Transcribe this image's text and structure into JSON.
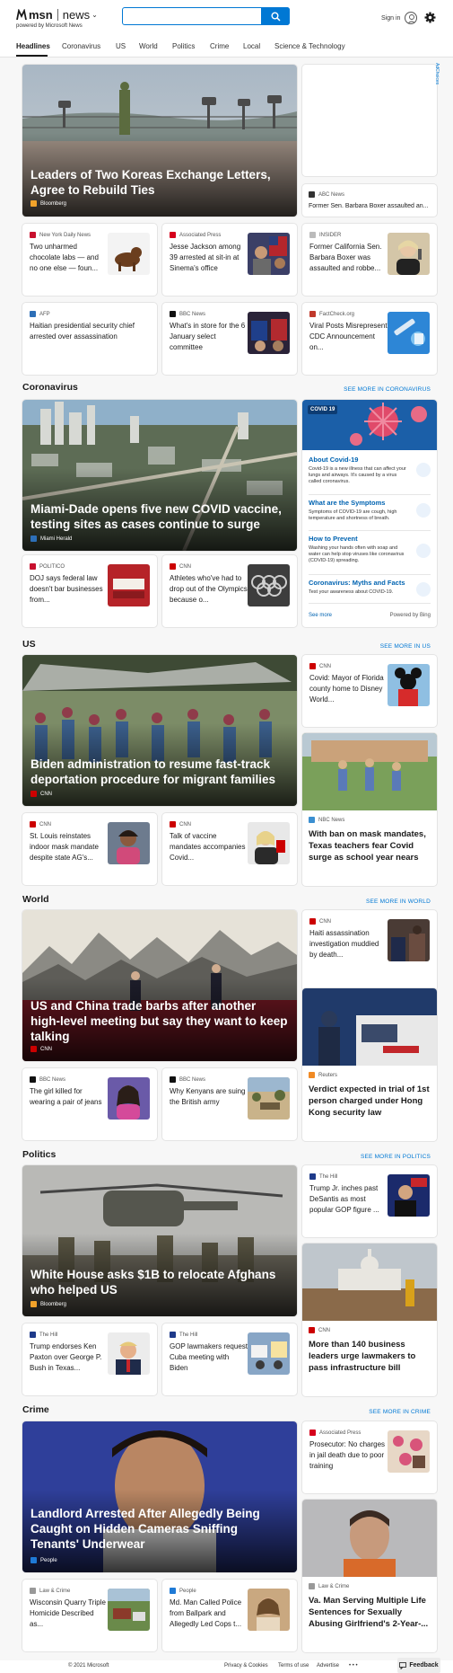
{
  "header": {
    "brand_msn": "msn",
    "brand_news": "news",
    "powered_by": "powered by Microsoft News",
    "search_placeholder": "",
    "sign_in": "Sign in"
  },
  "nav": {
    "items": [
      "Headlines",
      "Coronavirus",
      "US",
      "World",
      "Politics",
      "Crime",
      "Local",
      "Science & Technology"
    ]
  },
  "colors": {
    "accent": "#0078d4",
    "covid_blue": "#1b5fa8",
    "link_blue": "#0063b1"
  },
  "headlines": {
    "hero": {
      "title": "Leaders of Two Koreas Exchange Letters, Agree to Rebuild Ties",
      "source": "Bloomberg"
    },
    "side": {
      "source": "ABC News",
      "title": "Former Sen. Barbara Boxer assaulted an..."
    },
    "adchoices": "AdChoices",
    "cards": [
      {
        "source": "New York Daily News",
        "title": "Two unharmed chocolate labs — and no one else — foun..."
      },
      {
        "source": "Associated Press",
        "title": "Jesse Jackson among 39 arrested at sit-in at Sinema's office"
      },
      {
        "source": "INSIDER",
        "title": "Former California Sen. Barbara Boxer was assaulted and robbe..."
      },
      {
        "source": "AFP",
        "title": "Haitian presidential security chief arrested over assassination"
      },
      {
        "source": "BBC News",
        "title": "What's in store for the 6 January select committee"
      },
      {
        "source": "FactCheck.org",
        "title": "Viral Posts Misrepresent CDC Announcement on..."
      }
    ]
  },
  "coronavirus": {
    "heading": "Coronavirus",
    "see_more": "SEE MORE IN CORONAVIRUS",
    "hero": {
      "title": "Miami-Dade opens five new COVID vaccine, testing sites as cases continue to surge",
      "source": "Miami Herald"
    },
    "cards": [
      {
        "source": "POLITICO",
        "title": "DOJ says federal law doesn't bar businesses from..."
      },
      {
        "source": "CNN",
        "title": "Athletes who've had to drop out of the Olympics because o..."
      }
    ],
    "widget": {
      "badge": "COVID 19",
      "items": [
        {
          "title": "About Covid-19",
          "text": "Covid-19 is a new illness that can affect your lungs and airways. It's caused by a virus called coronavirus."
        },
        {
          "title": "What are the Symptoms",
          "text": "Symptoms of COVID-19 are cough, high temperature and shortness of breath."
        },
        {
          "title": "How to Prevent",
          "text": "Washing your hands often with soap and water can help stop viruses like coronavirus (COVID-19) spreading."
        },
        {
          "title": "Coronavirus: Myths and Facts",
          "text": "Test your awareness about COVID-19."
        }
      ],
      "see_more": "See more",
      "powered": "Powered by Bing"
    }
  },
  "us": {
    "heading": "US",
    "see_more": "SEE MORE IN US",
    "hero": {
      "title": "Biden administration to resume fast-track deportation procedure for migrant families",
      "source": "CNN"
    },
    "side": {
      "source": "CNN",
      "title": "Covid: Mayor of Florida county home to Disney World..."
    },
    "big": {
      "source": "NBC News",
      "title": "With ban on mask mandates, Texas teachers fear Covid surge as school year nears"
    },
    "cards": [
      {
        "source": "CNN",
        "title": "St. Louis reinstates indoor mask mandate despite state AG's..."
      },
      {
        "source": "CNN",
        "title": "Talk of vaccine mandates accompanies Covid..."
      }
    ]
  },
  "world": {
    "heading": "World",
    "see_more": "SEE MORE IN WORLD",
    "hero": {
      "title": "US and China trade barbs after another high-level meeting but say they want to keep talking",
      "source": "CNN"
    },
    "side": {
      "source": "CNN",
      "title": "Haiti assassination investigation muddied by death..."
    },
    "big": {
      "source": "Reuters",
      "title": "Verdict expected in trial of 1st person charged under Hong Kong security law"
    },
    "cards": [
      {
        "source": "BBC News",
        "title": "The girl killed for wearing a pair of jeans"
      },
      {
        "source": "BBC News",
        "title": "Why Kenyans are suing the British army"
      }
    ]
  },
  "politics": {
    "heading": "Politics",
    "see_more": "SEE MORE IN POLITICS",
    "hero": {
      "title": "White House asks $1B to relocate Afghans who helped US",
      "source": "Bloomberg"
    },
    "side": {
      "source": "The Hill",
      "title": "Trump Jr. inches past DeSantis as most popular GOP figure ..."
    },
    "big": {
      "source": "CNN",
      "title": "More than 140 business leaders urge lawmakers to pass infrastructure bill"
    },
    "cards": [
      {
        "source": "The Hill",
        "title": "Trump endorses Ken Paxton over George P. Bush in Texas..."
      },
      {
        "source": "The Hill",
        "title": "GOP lawmakers request Cuba meeting with Biden"
      }
    ]
  },
  "crime": {
    "heading": "Crime",
    "see_more": "SEE MORE IN CRIME",
    "hero": {
      "title": "Landlord Arrested After Allegedly Being Caught on Hidden Cameras Sniffing Tenants' Underwear",
      "source": "People"
    },
    "side": {
      "source": "Associated Press",
      "title": "Prosecutor: No charges in jail death due to poor training"
    },
    "big": {
      "source": "Law & Crime",
      "title": "Va. Man Serving Multiple Life Sentences for Sexually Abusing Girlfriend's 2-Year-..."
    },
    "cards": [
      {
        "source": "Law & Crime",
        "title": "Wisconsin Quarry Triple Homicide Described as..."
      },
      {
        "source": "People",
        "title": "Md. Man Called Police from Ballpark and Allegedly Led Cops t..."
      }
    ]
  },
  "footer": {
    "copyright": "© 2021 Microsoft",
    "links": [
      "Privacy & Cookies",
      "Terms of use",
      "Advertise"
    ],
    "more": "• • •",
    "feedback": "Feedback"
  }
}
